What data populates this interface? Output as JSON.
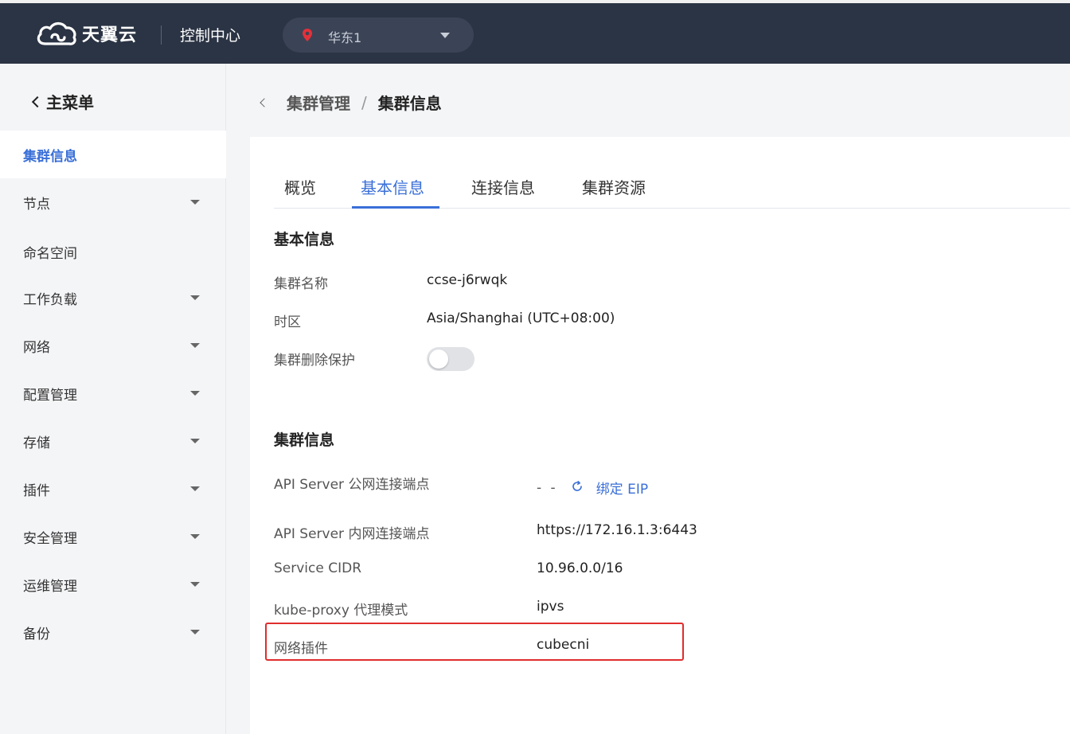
{
  "topbar": {
    "brand": "天翼云",
    "console_title": "控制中心",
    "region": "华东1"
  },
  "sidebar": {
    "back_label": "主菜单",
    "active_item": "集群信息",
    "items": [
      {
        "label": "节点",
        "expandable": true
      },
      {
        "label": "命名空间",
        "expandable": false
      },
      {
        "label": "工作负载",
        "expandable": true
      },
      {
        "label": "网络",
        "expandable": true
      },
      {
        "label": "配置管理",
        "expandable": true
      },
      {
        "label": "存储",
        "expandable": true
      },
      {
        "label": "插件",
        "expandable": true
      },
      {
        "label": "安全管理",
        "expandable": true
      },
      {
        "label": "运维管理",
        "expandable": true
      },
      {
        "label": "备份",
        "expandable": true
      }
    ]
  },
  "breadcrumb": {
    "parent": "集群管理",
    "separator": "/",
    "current": "集群信息"
  },
  "tabs": [
    {
      "label": "概览",
      "active": false
    },
    {
      "label": "基本信息",
      "active": true
    },
    {
      "label": "连接信息",
      "active": false
    },
    {
      "label": "集群资源",
      "active": false
    }
  ],
  "basic_info": {
    "title": "基本信息",
    "cluster_name_label": "集群名称",
    "cluster_name": "ccse-j6rwqk",
    "timezone_label": "时区",
    "timezone": "Asia/Shanghai (UTC+08:00)",
    "delete_protection_label": "集群删除保护",
    "delete_protection_enabled": false
  },
  "cluster_info": {
    "title": "集群信息",
    "public_endpoint_label": "API Server 公网连接端点",
    "public_endpoint_value": "- -",
    "bind_eip_label": "绑定 EIP",
    "private_endpoint_label": "API Server 内网连接端点",
    "private_endpoint_value": "https://172.16.1.3:6443",
    "service_cidr_label": "Service CIDR",
    "service_cidr_value": "10.96.0.0/16",
    "kube_proxy_label": "kube-proxy 代理模式",
    "kube_proxy_value": "ipvs",
    "network_plugin_label": "网络插件",
    "network_plugin_value": "cubecni"
  },
  "colors": {
    "topbar_bg": "#2b3444",
    "accent": "#3a6fd8",
    "highlight_border": "#e02d2d",
    "region_pin": "#e5303a"
  },
  "icons": {
    "logo": "cloud-logo-icon",
    "region_pin": "location-pin-icon",
    "region_caret": "caret-down-icon",
    "back": "chevron-left-icon",
    "refresh": "refresh-icon"
  }
}
